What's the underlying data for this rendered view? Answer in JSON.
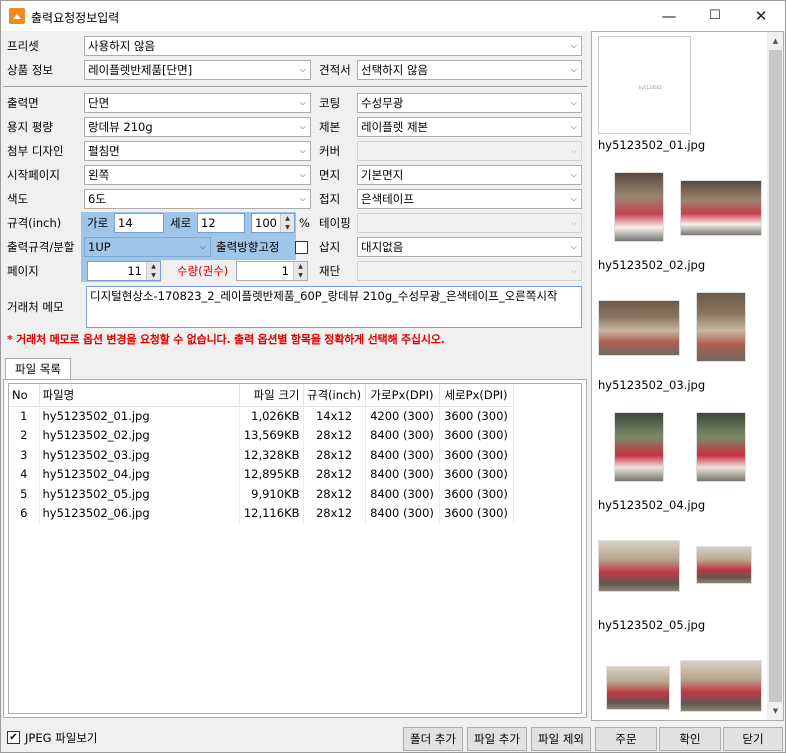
{
  "window": {
    "title": "출력요청정보입력",
    "minimize": "—",
    "maximize": "☐",
    "close": "✕"
  },
  "labels": {
    "preset": "프리셋",
    "product": "상품 정보",
    "estimate": "견적서",
    "side": "출력면",
    "coating": "코팅",
    "paper": "용지 평량",
    "binding": "제본",
    "attach_design": "첨부 디자인",
    "cover": "커버",
    "start_page": "시작페이지",
    "endpaper": "면지",
    "color": "색도",
    "adhesive": "접지",
    "size": "규격(inch)",
    "width": "가로",
    "height": "세로",
    "percent": "%",
    "taping": "테이핑",
    "output_size": "출력규격/분할",
    "direction_fixed": "출력방향고정",
    "insert": "삽지",
    "page": "페이지",
    "quantity": "수량(권수)",
    "cutting": "재단",
    "memo": "거래처 메모"
  },
  "values": {
    "preset": "사용하지 않음",
    "product": "레이플렛반제품[단면]",
    "estimate": "선택하지 않음",
    "side": "단면",
    "coating": "수성무광",
    "paper": "랑데뷰 210g",
    "binding": "레이플렛 제본",
    "attach_design": "펼침면",
    "cover": "",
    "start_page": "왼쪽",
    "endpaper": "기본면지",
    "color": "6도",
    "adhesive": "은색테이프",
    "width": "14",
    "height": "12",
    "scale": "100",
    "taping": "",
    "output_size": "1UP",
    "insert": "대지없음",
    "page": "11",
    "quantity": "1",
    "cutting": "",
    "memo": "디지털현상소-170823_2_레이플렛반제품_60P_랑데뷰 210g_수성무광_은색테이프_오른쪽시작"
  },
  "warning": "* 거래처 메모로 옵션 변경을 요청할 수 없습니다. 출력 옵션별 항목을 정확하게 선택해 주십시오.",
  "tab": "파일 목록",
  "table": {
    "headers": [
      "No",
      "파일명",
      "파일 크기",
      "규격(inch)",
      "가로Px(DPI)",
      "세로Px(DPI)"
    ],
    "rows": [
      [
        "1",
        "hy5123502_01.jpg",
        "1,026KB",
        "14x12",
        "4200 (300)",
        "3600 (300)"
      ],
      [
        "2",
        "hy5123502_02.jpg",
        "13,569KB",
        "28x12",
        "8400 (300)",
        "3600 (300)"
      ],
      [
        "3",
        "hy5123502_03.jpg",
        "12,328KB",
        "28x12",
        "8400 (300)",
        "3600 (300)"
      ],
      [
        "4",
        "hy5123502_04.jpg",
        "12,895KB",
        "28x12",
        "8400 (300)",
        "3600 (300)"
      ],
      [
        "5",
        "hy5123502_05.jpg",
        "9,910KB",
        "28x12",
        "8400 (300)",
        "3600 (300)"
      ],
      [
        "6",
        "hy5123502_06.jpg",
        "12,116KB",
        "28x12",
        "8400 (300)",
        "3600 (300)"
      ]
    ]
  },
  "thumbnails": [
    "hy5123502_01.jpg",
    "hy5123502_02.jpg",
    "hy5123502_03.jpg",
    "hy5123502_04.jpg",
    "hy5123502_05.jpg"
  ],
  "thumb_page_text": "hy5123502",
  "bottom": {
    "jpeg_view": "JPEG 파일보기",
    "add_folder": "폴더 추가",
    "add_file": "파일 추가",
    "remove_file": "파일 제외",
    "order": "주문",
    "confirm": "확인",
    "close": "닫기"
  },
  "icons": {
    "dropdown": "chevron-down-icon",
    "spin_up": "▲",
    "spin_down": "▼",
    "scroll_up": "▲",
    "scroll_down": "▼",
    "check": "✔"
  },
  "colors": {
    "highlight": "#9fc5e8",
    "warning": "#e00000",
    "quantity_label": "#e00000"
  }
}
